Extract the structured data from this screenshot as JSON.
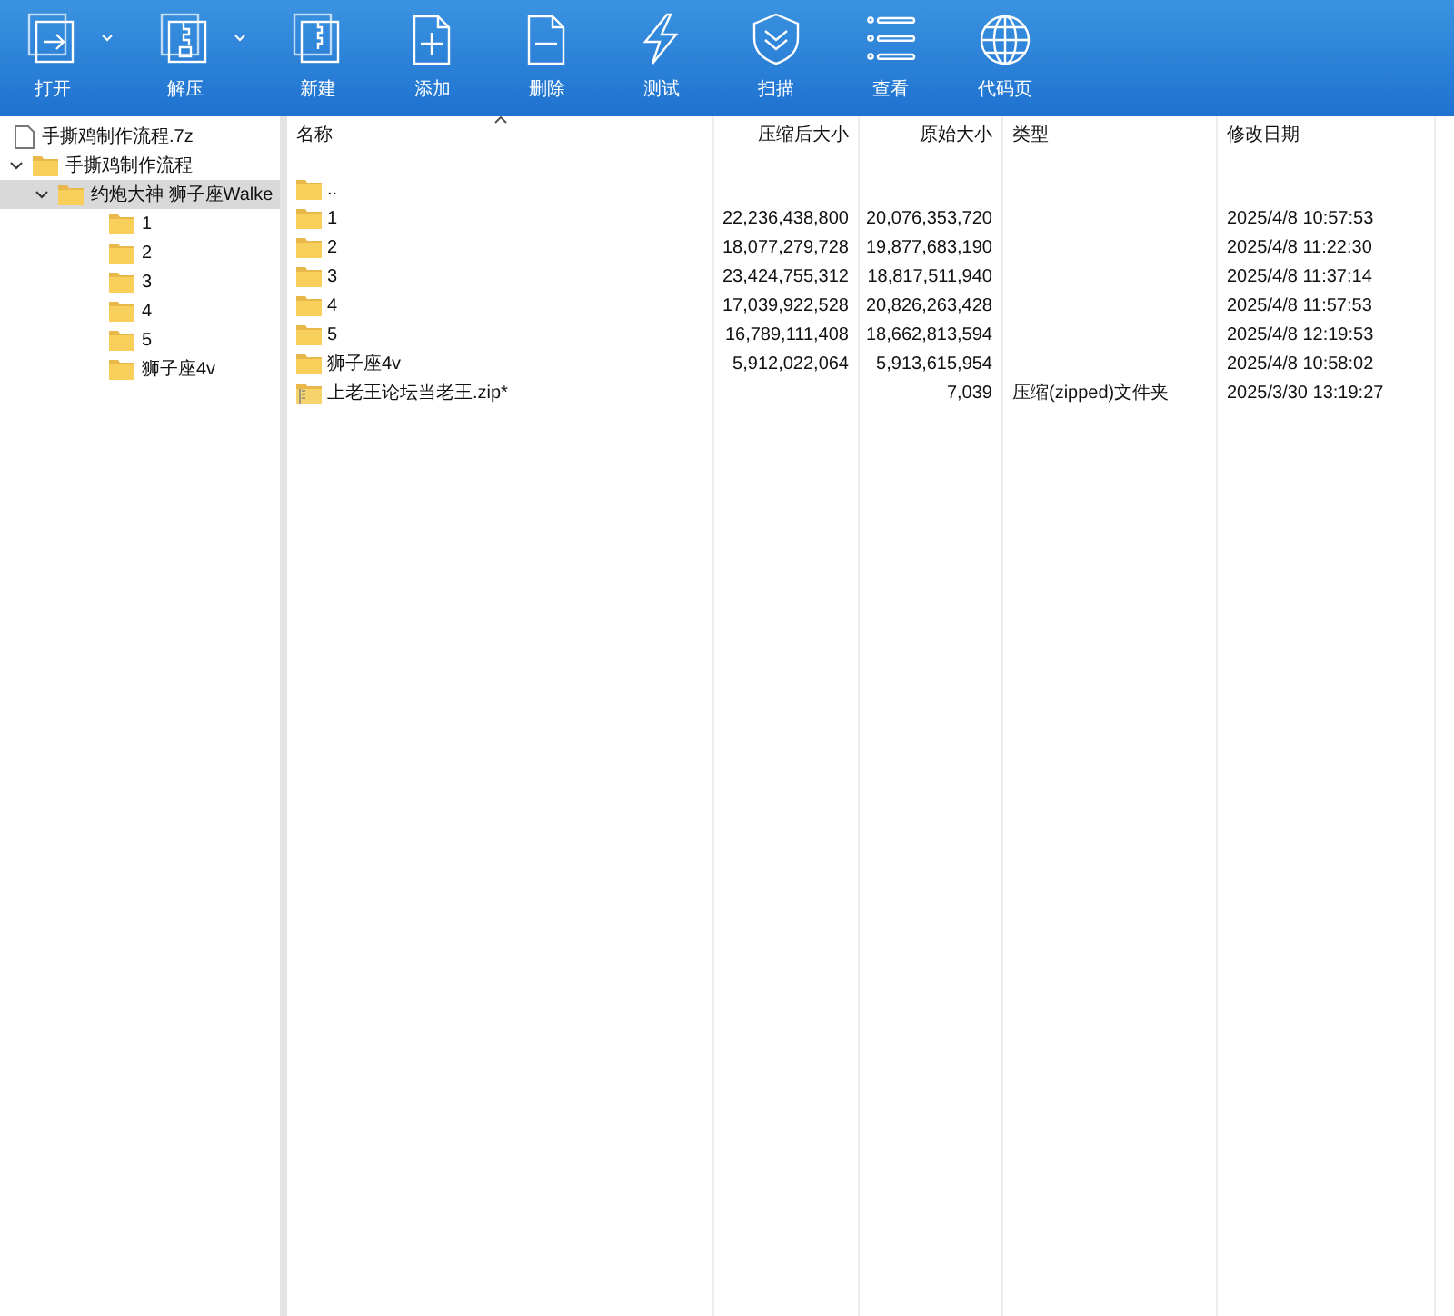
{
  "toolbar": [
    {
      "kind": "open",
      "label": "打开",
      "has_menu": true
    },
    {
      "kind": "extract",
      "label": "解压",
      "has_menu": true
    },
    {
      "kind": "new",
      "label": "新建",
      "has_menu": false
    },
    {
      "kind": "add",
      "label": "添加",
      "has_menu": false
    },
    {
      "kind": "delete",
      "label": "删除",
      "has_menu": false
    },
    {
      "kind": "test",
      "label": "测试",
      "has_menu": false
    },
    {
      "kind": "scan",
      "label": "扫描",
      "has_menu": false
    },
    {
      "kind": "view",
      "label": "查看",
      "has_menu": false
    },
    {
      "kind": "codepage",
      "label": "代码页",
      "has_menu": false
    }
  ],
  "tree": [
    {
      "kind": "file",
      "label": "手撕鸡制作流程.7z",
      "selected": false
    },
    {
      "kind": "folder",
      "label": "手撕鸡制作流程",
      "selected": false,
      "expanded": true,
      "children": [
        {
          "kind": "folder",
          "label": "约炮大神 狮子座Walke",
          "selected": true,
          "expanded": true,
          "children": [
            {
              "kind": "folder",
              "label": "1",
              "selected": false
            },
            {
              "kind": "folder",
              "label": "2",
              "selected": false
            },
            {
              "kind": "folder",
              "label": "3",
              "selected": false
            },
            {
              "kind": "folder",
              "label": "4",
              "selected": false
            },
            {
              "kind": "folder",
              "label": "5",
              "selected": false
            },
            {
              "kind": "folder",
              "label": "狮子座4v",
              "selected": false
            }
          ]
        }
      ]
    }
  ],
  "table": {
    "columns": [
      {
        "label": "名称",
        "sorted": true
      },
      {
        "label": "压缩后大小",
        "sorted": false
      },
      {
        "label": "原始大小",
        "sorted": false
      },
      {
        "label": "类型",
        "sorted": false
      },
      {
        "label": "修改日期",
        "sorted": false
      }
    ],
    "rows": [
      {
        "kind": "folder",
        "name": "..",
        "packed": "",
        "size": "",
        "type": "",
        "modified": ""
      },
      {
        "kind": "folder",
        "name": "1",
        "packed": "22,236,438,800",
        "size": "20,076,353,720",
        "type": "",
        "modified": "2025/4/8 10:57:53"
      },
      {
        "kind": "folder",
        "name": "2",
        "packed": "18,077,279,728",
        "size": "19,877,683,190",
        "type": "",
        "modified": "2025/4/8 11:22:30"
      },
      {
        "kind": "folder",
        "name": "3",
        "packed": "23,424,755,312",
        "size": "18,817,511,940",
        "type": "",
        "modified": "2025/4/8 11:37:14"
      },
      {
        "kind": "folder",
        "name": "4",
        "packed": "17,039,922,528",
        "size": "20,826,263,428",
        "type": "",
        "modified": "2025/4/8 11:57:53"
      },
      {
        "kind": "folder",
        "name": "5",
        "packed": "16,789,111,408",
        "size": "18,662,813,594",
        "type": "",
        "modified": "2025/4/8 12:19:53"
      },
      {
        "kind": "folder",
        "name": "狮子座4v",
        "packed": "5,912,022,064",
        "size": "5,913,615,954",
        "type": "",
        "modified": "2025/4/8 10:58:02"
      },
      {
        "kind": "zip",
        "name": "上老王论坛当老王.zip*",
        "packed": "",
        "size": "7,039",
        "type": "压缩(zipped)文件夹",
        "modified": "2025/3/30 13:19:27"
      }
    ]
  }
}
